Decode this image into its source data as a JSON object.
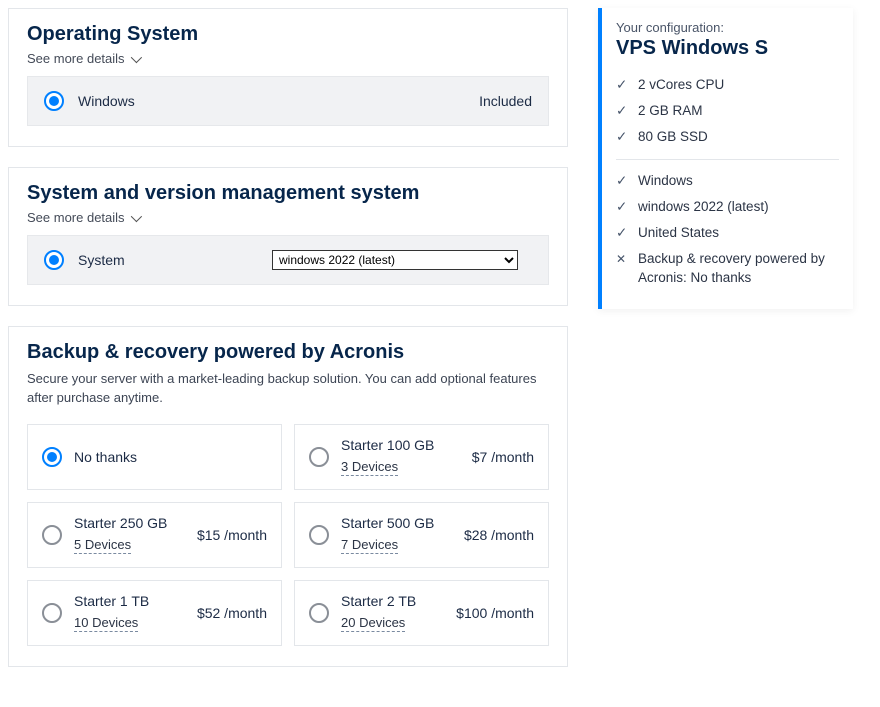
{
  "os_section": {
    "title": "Operating System",
    "see_more": "See more details",
    "option_label": "Windows",
    "included_label": "Included"
  },
  "version_section": {
    "title": "System and version management system",
    "see_more": "See more details",
    "option_label": "System",
    "selected": "windows 2022 (latest)",
    "options": [
      "windows 2022 (latest)"
    ]
  },
  "backup_section": {
    "title": "Backup & recovery powered by Acronis",
    "description": "Secure your server with a market-leading backup solution. You can add optional features after purchase anytime.",
    "plans": [
      {
        "name": "No thanks",
        "devices": "",
        "price": "",
        "selected": true
      },
      {
        "name": "Starter 100 GB",
        "devices": "3 Devices",
        "price": "$7 /month",
        "selected": false
      },
      {
        "name": "Starter 250 GB",
        "devices": "5 Devices",
        "price": "$15 /month",
        "selected": false
      },
      {
        "name": "Starter 500 GB",
        "devices": "7 Devices",
        "price": "$28 /month",
        "selected": false
      },
      {
        "name": "Starter 1 TB",
        "devices": "10 Devices",
        "price": "$52 /month",
        "selected": false
      },
      {
        "name": "Starter 2 TB",
        "devices": "20 Devices",
        "price": "$100 /month",
        "selected": false
      }
    ]
  },
  "sidebar": {
    "label": "Your configuration:",
    "title": "VPS Windows S",
    "specs": [
      "2 vCores CPU",
      "2 GB RAM",
      "80 GB SSD"
    ],
    "config": [
      {
        "mark": "check",
        "text": "Windows"
      },
      {
        "mark": "check",
        "text": "windows 2022 (latest)"
      },
      {
        "mark": "check",
        "text": "United States"
      },
      {
        "mark": "x",
        "text": "Backup & recovery powered by Acronis: No thanks"
      }
    ]
  }
}
